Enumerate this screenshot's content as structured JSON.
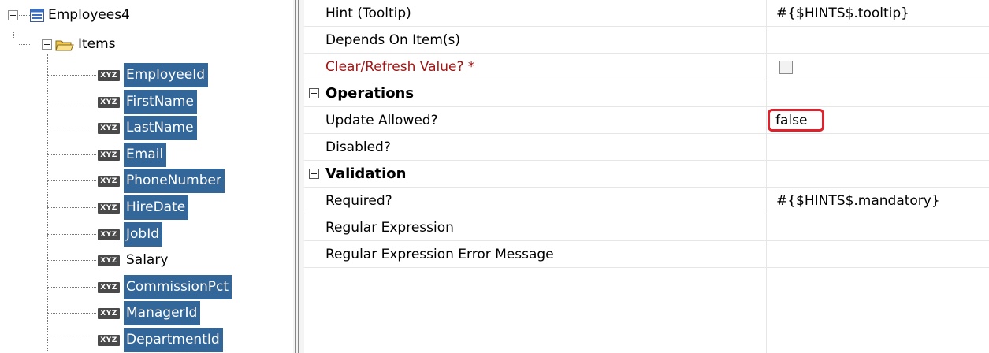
{
  "tree": {
    "root_label": "Employees4",
    "folder_label": "Items",
    "items": [
      {
        "label": "EmployeeId",
        "selected": true
      },
      {
        "label": "FirstName",
        "selected": true
      },
      {
        "label": "LastName",
        "selected": true
      },
      {
        "label": "Email",
        "selected": true
      },
      {
        "label": "PhoneNumber",
        "selected": true
      },
      {
        "label": "HireDate",
        "selected": true
      },
      {
        "label": "JobId",
        "selected": true
      },
      {
        "label": "Salary",
        "selected": false
      },
      {
        "label": "CommissionPct",
        "selected": true
      },
      {
        "label": "ManagerId",
        "selected": true
      },
      {
        "label": "DepartmentId",
        "selected": true
      }
    ],
    "attr_icon_text": "XYZ"
  },
  "properties": {
    "hint": {
      "name": "Hint (Tooltip)",
      "value": "#{$HINTS$.tooltip}"
    },
    "depends_on": {
      "name": "Depends On Item(s)",
      "value": ""
    },
    "clear_refresh": {
      "name": "Clear/Refresh Value? *",
      "checked": false
    },
    "operations_category": "Operations",
    "update_allowed": {
      "name": "Update Allowed?",
      "value": "false"
    },
    "disabled": {
      "name": "Disabled?",
      "value": ""
    },
    "validation_category": "Validation",
    "required": {
      "name": "Required?",
      "value": "#{$HINTS$.mandatory}"
    },
    "regex": {
      "name": "Regular Expression",
      "value": ""
    },
    "regex_error": {
      "name": "Regular Expression Error Message",
      "value": ""
    }
  },
  "colors": {
    "selection": "#336699",
    "required_label": "#a31515",
    "highlight": "#e0202a"
  }
}
